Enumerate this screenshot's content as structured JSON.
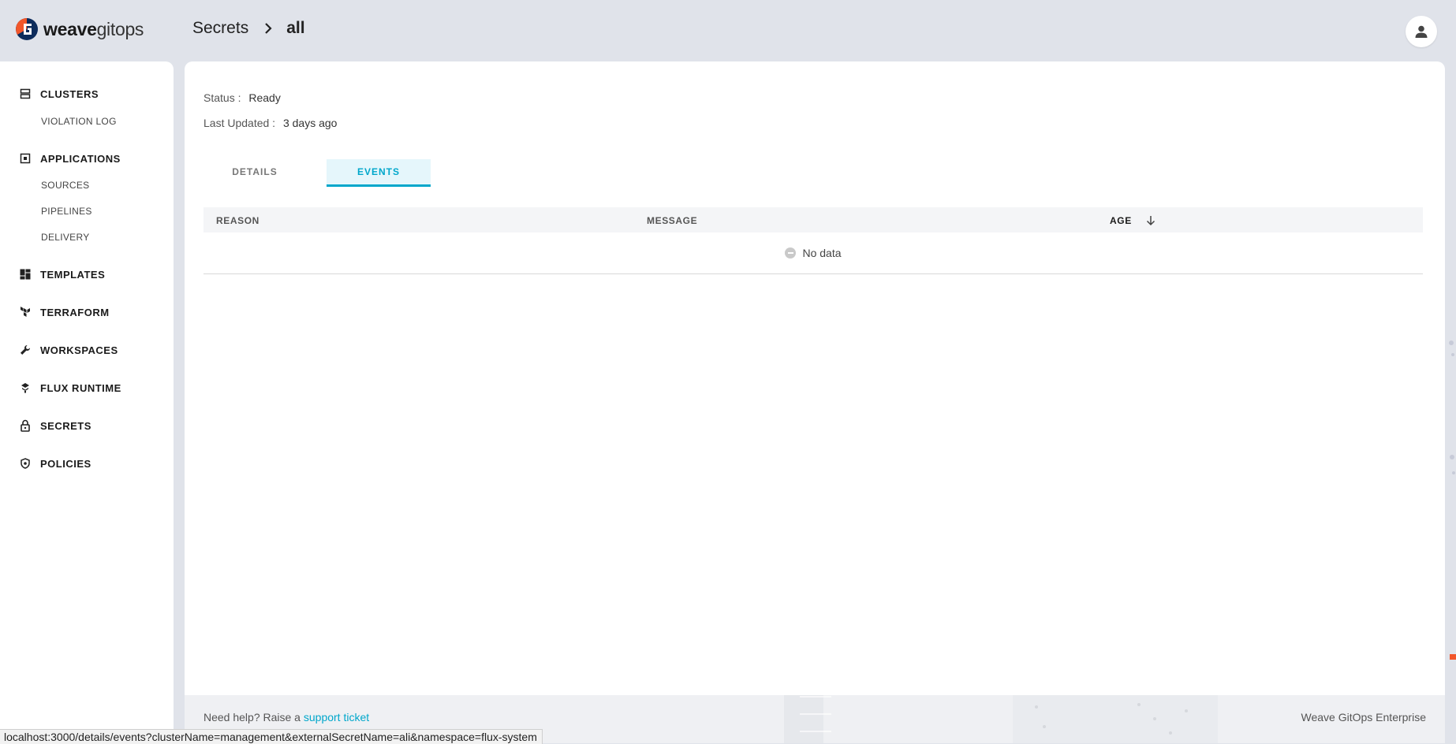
{
  "header": {
    "logo": {
      "weave": "weave",
      "gitops": "gitops"
    },
    "breadcrumb": {
      "parent": "Secrets",
      "current": "all"
    },
    "user_icon": "user-icon"
  },
  "sidebar": {
    "items": [
      {
        "label": "CLUSTERS",
        "icon": "clusters-icon"
      },
      {
        "label": "VIOLATION LOG",
        "sub": true
      },
      {
        "label": "APPLICATIONS",
        "icon": "applications-icon"
      },
      {
        "label": "SOURCES",
        "sub": true
      },
      {
        "label": "PIPELINES",
        "sub": true
      },
      {
        "label": "DELIVERY",
        "sub": true
      },
      {
        "label": "TEMPLATES",
        "icon": "templates-icon"
      },
      {
        "label": "TERRAFORM",
        "icon": "terraform-icon"
      },
      {
        "label": "WORKSPACES",
        "icon": "wrench-icon"
      },
      {
        "label": "FLUX RUNTIME",
        "icon": "flux-icon"
      },
      {
        "label": "SECRETS",
        "icon": "lock-icon"
      },
      {
        "label": "POLICIES",
        "icon": "shield-icon"
      }
    ]
  },
  "main": {
    "status_label": "Status :",
    "status_value": "Ready",
    "updated_label": "Last Updated :",
    "updated_value": "3 days ago",
    "tabs": [
      {
        "label": "DETAILS",
        "active": false
      },
      {
        "label": "EVENTS",
        "active": true
      }
    ],
    "table": {
      "columns": [
        "REASON",
        "MESSAGE",
        "AGE"
      ],
      "sort": "descending",
      "empty_text": "No data"
    }
  },
  "footer": {
    "help_text": "Need help? Raise a",
    "help_link": "support ticket",
    "brand": "Weave GitOps Enterprise"
  },
  "statusbar": {
    "url": "localhost:3000/details/events?clusterName=management&externalSecretName=ali&namespace=flux-system"
  },
  "colors": {
    "accent": "#00a7cb",
    "background": "#e0e3ea",
    "logo_orange": "#f2572b",
    "logo_navy": "#0d2c5c"
  }
}
